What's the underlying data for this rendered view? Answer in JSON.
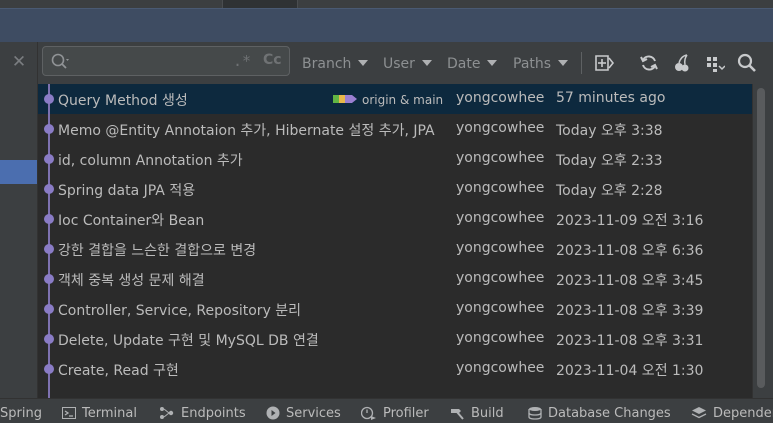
{
  "toolbar": {
    "search_placeholder": "",
    "regex_label": ".*",
    "case_label": "Cc",
    "filters": [
      "Branch",
      "User",
      "Date",
      "Paths"
    ]
  },
  "commits": [
    {
      "message": "Query Method 생성",
      "author": "yongcowhee",
      "date": "57 minutes ago",
      "tags": "origin & main",
      "selected": true
    },
    {
      "message": "Memo @Entity Annotaion 추가, Hibernate 설정 추가, JPA",
      "author": "yongcowhee",
      "date": "Today 오후 3:38"
    },
    {
      "message": "id, column Annotation 추가",
      "author": "yongcowhee",
      "date": "Today 오후 2:33"
    },
    {
      "message": "Spring data JPA 적용",
      "author": "yongcowhee",
      "date": "Today 오후 2:28"
    },
    {
      "message": "Ioc Container와 Bean",
      "author": "yongcowhee",
      "date": "2023-11-09 오전 3:16"
    },
    {
      "message": "강한 결합을 느슨한 결합으로 변경",
      "author": "yongcowhee",
      "date": "2023-11-08 오후 6:36"
    },
    {
      "message": "객체 중복 생성 문제 해결",
      "author": "yongcowhee",
      "date": "2023-11-08 오후 3:45"
    },
    {
      "message": "Controller, Service, Repository 분리",
      "author": "yongcowhee",
      "date": "2023-11-08 오후 3:39"
    },
    {
      "message": "Delete, Update 구현 및 MySQL DB 연결",
      "author": "yongcowhee",
      "date": "2023-11-08 오후 3:31"
    },
    {
      "message": "Create, Read 구현",
      "author": "yongcowhee",
      "date": "2023-11-04 오전 1:30"
    }
  ],
  "statusbar": {
    "spring": "Spring",
    "terminal": "Terminal",
    "endpoints": "Endpoints",
    "services": "Services",
    "profiler": "Profiler",
    "build": "Build",
    "database_changes": "Database Changes",
    "dependencies": "Dependencies"
  },
  "colors": {
    "accent": "#4b6eaf",
    "selected_row": "#0d293e",
    "graph": "#8a7cc6",
    "tag_green": "#62b543",
    "tag_yellow": "#e8b84a",
    "tag_purple": "#9b7fd1"
  },
  "icons": [
    "close-icon",
    "search-icon",
    "new-branch-icon",
    "refresh-icon",
    "cherry-pick-icon",
    "layout-icon",
    "find-icon"
  ]
}
